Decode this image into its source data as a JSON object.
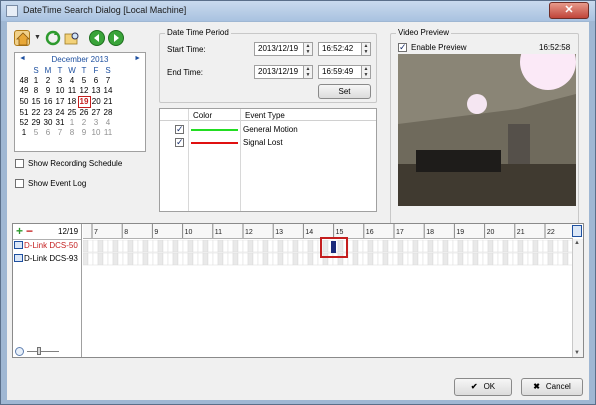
{
  "window": {
    "title": "DateTime Search Dialog [Local Machine]",
    "close_glyph": "✕"
  },
  "toolbar": {
    "icons": [
      "home-icon",
      "dropdown-arrow-icon",
      "refresh-icon",
      "folder-search-icon",
      "back-icon",
      "forward-icon"
    ]
  },
  "calendar": {
    "nav_prev": "◄",
    "nav_next": "►",
    "month_label": "December 2013",
    "weekdays": [
      "S",
      "M",
      "T",
      "W",
      "T",
      "F",
      "S"
    ],
    "weeks": [
      {
        "num": "48",
        "days": [
          "1",
          "2",
          "3",
          "4",
          "5",
          "6",
          "7"
        ]
      },
      {
        "num": "49",
        "days": [
          "8",
          "9",
          "10",
          "11",
          "12",
          "13",
          "14"
        ]
      },
      {
        "num": "50",
        "days": [
          "15",
          "16",
          "17",
          "18",
          "19",
          "20",
          "21"
        ]
      },
      {
        "num": "51",
        "days": [
          "22",
          "23",
          "24",
          "25",
          "26",
          "27",
          "28"
        ]
      },
      {
        "num": "52",
        "days": [
          "29",
          "30",
          "31",
          "1",
          "2",
          "3",
          "4"
        ]
      },
      {
        "num": "1",
        "days": [
          "5",
          "6",
          "7",
          "8",
          "9",
          "10",
          "11"
        ]
      }
    ],
    "today": "19"
  },
  "options": {
    "show_recording_schedule": "Show Recording Schedule",
    "show_event_log": "Show Event Log"
  },
  "date_time_period": {
    "title": "Date Time Period",
    "start_label": "Start Time:",
    "start_date": "2013/12/19",
    "start_time": "16:52:42",
    "end_label": "End Time:",
    "end_date": "2013/12/19",
    "end_time": "16:59:49",
    "set_button": "Set"
  },
  "event_table": {
    "col_color": "Color",
    "col_event_type": "Event Type",
    "rows": [
      {
        "checked": true,
        "color": "#22dd22",
        "label": "General Motion"
      },
      {
        "checked": true,
        "color": "#e01010",
        "label": "Signal Lost"
      }
    ]
  },
  "video_preview": {
    "title": "Video Preview",
    "enable_label": "Enable Preview",
    "timestamp": "16:52:58"
  },
  "timeline": {
    "date_label": "12/19",
    "add_glyph": "+",
    "remove_glyph": "−",
    "hours": [
      "7",
      "8",
      "9",
      "10",
      "11",
      "12",
      "13",
      "14",
      "15",
      "16",
      "17",
      "18",
      "19",
      "20",
      "21",
      "22"
    ],
    "cameras": [
      {
        "name": "D-Link DCS-50",
        "color": "#c41e1e"
      },
      {
        "name": "D-Link DCS-93",
        "color": "#000000"
      }
    ]
  },
  "buttons": {
    "ok": "OK",
    "cancel": "Cancel"
  }
}
